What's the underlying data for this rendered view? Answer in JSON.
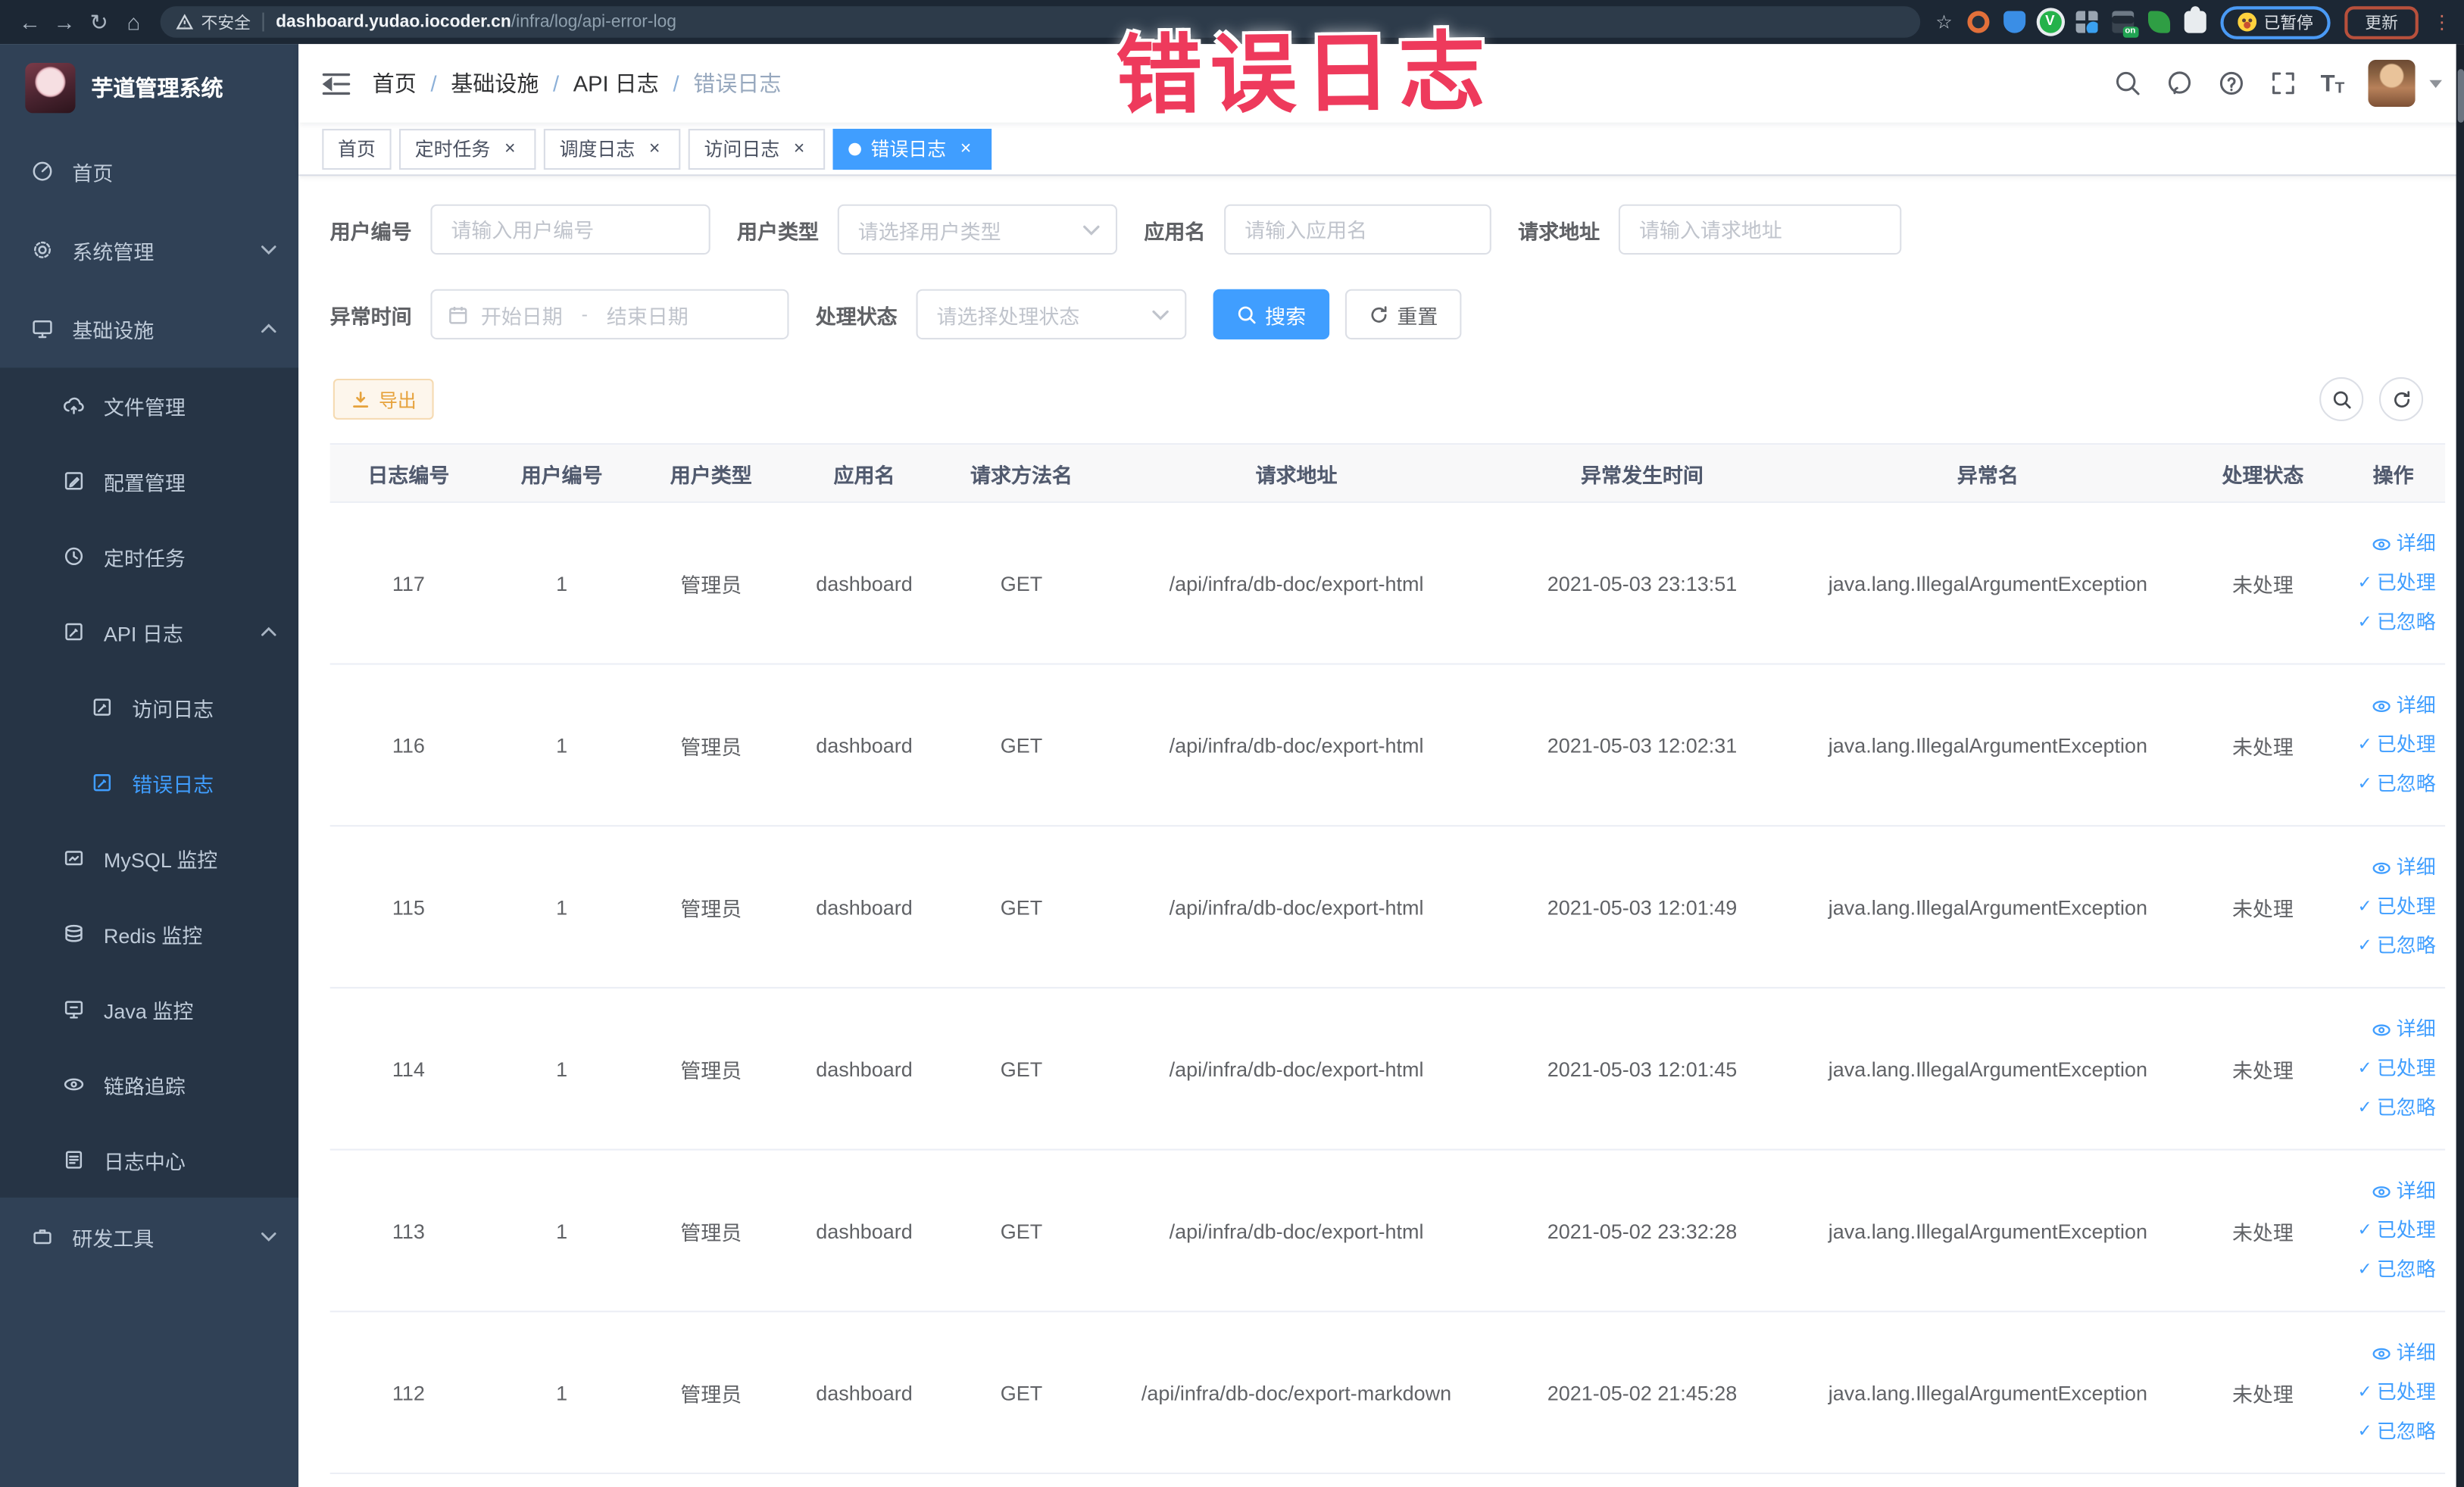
{
  "colors": {
    "accent": "#409eff",
    "warning": "#e6a23c",
    "annotation_red": "#ee3a5c",
    "sidebar_bg": "#304156",
    "submenu_bg": "#263445",
    "chrome_bg": "#1c2734"
  },
  "icons": {
    "back": "←",
    "forward": "→",
    "reload": "↻",
    "home": "⌂",
    "bookmark_star": "☆",
    "kebab_menu": "⋮",
    "check": "✓",
    "close": "×",
    "help": "?",
    "font_size": "T"
  },
  "chrome": {
    "insecure_label": "不安全",
    "url_host": "dashboard.yudao.iocoder.cn",
    "url_path": "/infra/log/api-error-log",
    "on_badge": "on",
    "paused_label": "已暂停",
    "update_label": "更新"
  },
  "annotation": {
    "text": "错误日志"
  },
  "sidebar": {
    "title": "芋道管理系统",
    "items": [
      {
        "label": "首页"
      },
      {
        "label": "系统管理"
      },
      {
        "label": "基础设施"
      },
      {
        "label": "文件管理"
      },
      {
        "label": "配置管理"
      },
      {
        "label": "定时任务"
      },
      {
        "label": "API 日志"
      },
      {
        "label": "访问日志"
      },
      {
        "label": "错误日志",
        "active": true
      },
      {
        "label": "MySQL 监控"
      },
      {
        "label": "Redis 监控"
      },
      {
        "label": "Java 监控"
      },
      {
        "label": "链路追踪"
      },
      {
        "label": "日志中心"
      },
      {
        "label": "研发工具"
      }
    ]
  },
  "navbar": {
    "breadcrumb": [
      "首页",
      "基础设施",
      "API 日志",
      "错误日志"
    ]
  },
  "tabs": [
    {
      "label": "首页",
      "closable": false,
      "active": false
    },
    {
      "label": "定时任务",
      "closable": true,
      "active": false
    },
    {
      "label": "调度日志",
      "closable": true,
      "active": false
    },
    {
      "label": "访问日志",
      "closable": true,
      "active": false
    },
    {
      "label": "错误日志",
      "closable": true,
      "active": true
    }
  ],
  "search": {
    "user_id": {
      "label": "用户编号",
      "placeholder": "请输入用户编号"
    },
    "user_type": {
      "label": "用户类型",
      "placeholder": "请选择用户类型"
    },
    "app_name": {
      "label": "应用名",
      "placeholder": "请输入应用名"
    },
    "request_url": {
      "label": "请求地址",
      "placeholder": "请输入请求地址"
    },
    "exception_time": {
      "label": "异常时间",
      "start_placeholder": "开始日期",
      "separator": "-",
      "end_placeholder": "结束日期"
    },
    "process_status": {
      "label": "处理状态",
      "placeholder": "请选择处理状态"
    },
    "search_label": "搜索",
    "reset_label": "重置"
  },
  "toolbar": {
    "export_label": "导出"
  },
  "table": {
    "columns": [
      "日志编号",
      "用户编号",
      "用户类型",
      "应用名",
      "请求方法名",
      "请求地址",
      "异常发生时间",
      "异常名",
      "处理状态",
      "操作"
    ],
    "actions": {
      "detail": "详细",
      "processed": "已处理",
      "ignored": "已忽略"
    },
    "rows": [
      {
        "id": "117",
        "user_id": "1",
        "user_type": "管理员",
        "app_name": "dashboard",
        "method": "GET",
        "url": "/api/infra/db-doc/export-html",
        "time": "2021-05-03 23:13:51",
        "exception": "java.lang.IllegalArgumentException",
        "status": "未处理"
      },
      {
        "id": "116",
        "user_id": "1",
        "user_type": "管理员",
        "app_name": "dashboard",
        "method": "GET",
        "url": "/api/infra/db-doc/export-html",
        "time": "2021-05-03 12:02:31",
        "exception": "java.lang.IllegalArgumentException",
        "status": "未处理"
      },
      {
        "id": "115",
        "user_id": "1",
        "user_type": "管理员",
        "app_name": "dashboard",
        "method": "GET",
        "url": "/api/infra/db-doc/export-html",
        "time": "2021-05-03 12:01:49",
        "exception": "java.lang.IllegalArgumentException",
        "status": "未处理"
      },
      {
        "id": "114",
        "user_id": "1",
        "user_type": "管理员",
        "app_name": "dashboard",
        "method": "GET",
        "url": "/api/infra/db-doc/export-html",
        "time": "2021-05-03 12:01:45",
        "exception": "java.lang.IllegalArgumentException",
        "status": "未处理"
      },
      {
        "id": "113",
        "user_id": "1",
        "user_type": "管理员",
        "app_name": "dashboard",
        "method": "GET",
        "url": "/api/infra/db-doc/export-html",
        "time": "2021-05-02 23:32:28",
        "exception": "java.lang.IllegalArgumentException",
        "status": "未处理"
      },
      {
        "id": "112",
        "user_id": "1",
        "user_type": "管理员",
        "app_name": "dashboard",
        "method": "GET",
        "url": "/api/infra/db-doc/export-markdown",
        "time": "2021-05-02 21:45:28",
        "exception": "java.lang.IllegalArgumentException",
        "status": "未处理"
      }
    ]
  }
}
